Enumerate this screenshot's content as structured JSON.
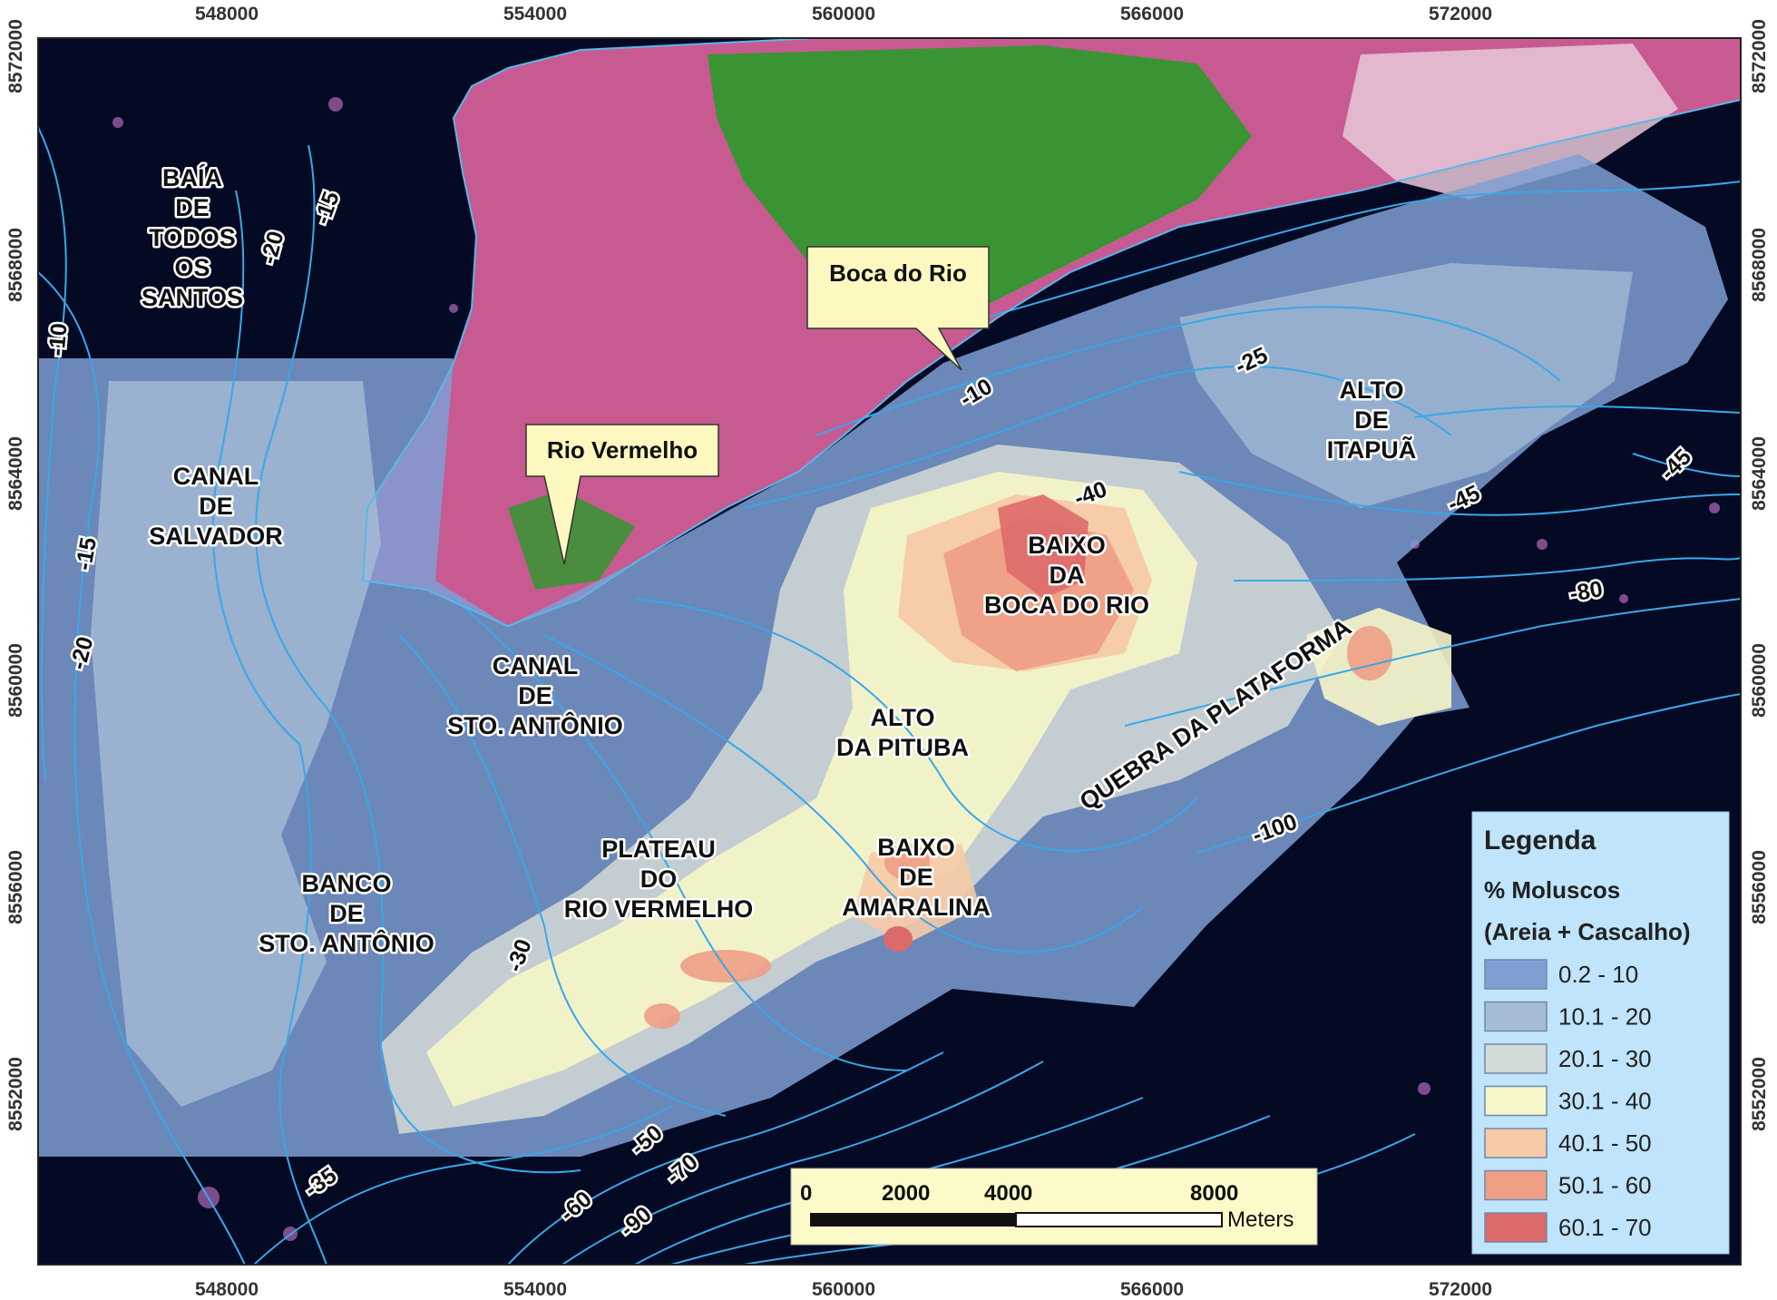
{
  "axes": {
    "x_ticks": [
      "548000",
      "554000",
      "560000",
      "566000",
      "572000"
    ],
    "y_ticks": [
      "8572000",
      "8568000",
      "8564000",
      "8560000",
      "8556000",
      "8552000"
    ]
  },
  "callouts": [
    {
      "label": "Boca do Rio"
    },
    {
      "label": "Rio Vermelho"
    }
  ],
  "place_labels": [
    {
      "lines": [
        "BAÍA",
        "DE",
        "TODOS",
        "OS",
        "SANTOS"
      ]
    },
    {
      "lines": [
        "CANAL",
        "DE",
        "SALVADOR"
      ]
    },
    {
      "lines": [
        "CANAL",
        "DE",
        "STO. ANTÔNIO"
      ]
    },
    {
      "lines": [
        "ALTO",
        "DA PITUBA"
      ]
    },
    {
      "lines": [
        "BAIXO",
        "DA",
        "BOCA DO RIO"
      ]
    },
    {
      "lines": [
        "ALTO",
        "DE",
        "ITAPUÃ"
      ]
    },
    {
      "lines": [
        "BANCO",
        "DE",
        "STO. ANTÔNIO"
      ]
    },
    {
      "lines": [
        "PLATEAU",
        "DO",
        "RIO VERMELHO"
      ]
    },
    {
      "lines": [
        "BAIXO",
        "DE",
        "AMARALINA"
      ]
    },
    {
      "lines": [
        "QUEBRA DA PLATAFORMA"
      ]
    }
  ],
  "contour_labels": [
    "-15",
    "-20",
    "-10",
    "-15",
    "-20",
    "-10",
    "-25",
    "-40",
    "-45",
    "-45",
    "-80",
    "-100",
    "-30",
    "-50",
    "-70",
    "-35",
    "-60",
    "-90"
  ],
  "legend": {
    "title": "Legenda",
    "subtitle1": "% Moluscos",
    "subtitle2": "(Areia + Cascalho)",
    "classes": [
      {
        "label": "0.2 - 10",
        "color": "#7f9fd3"
      },
      {
        "label": "10.1 - 20",
        "color": "#a6bcd6"
      },
      {
        "label": "20.1 - 30",
        "color": "#d3dbd6"
      },
      {
        "label": "30.1 - 40",
        "color": "#f7f6c8"
      },
      {
        "label": "40.1 - 50",
        "color": "#f6caa6"
      },
      {
        "label": "50.1 - 60",
        "color": "#ee9f86"
      },
      {
        "label": "60.1 - 70",
        "color": "#dd6a6a"
      }
    ]
  },
  "scale_bar": {
    "labels": [
      "0",
      "2000",
      "4000",
      "8000"
    ],
    "unit": "Meters"
  },
  "colors": {
    "sea": "#050a24",
    "land_urban": "#c85a92",
    "land_vegetation": "#2a9a2a",
    "contour": "#38a8e8",
    "legend_bg": "#bfe4fb",
    "scale_bg": "#fcfac8",
    "callout_bg": "#fcf8c0"
  }
}
